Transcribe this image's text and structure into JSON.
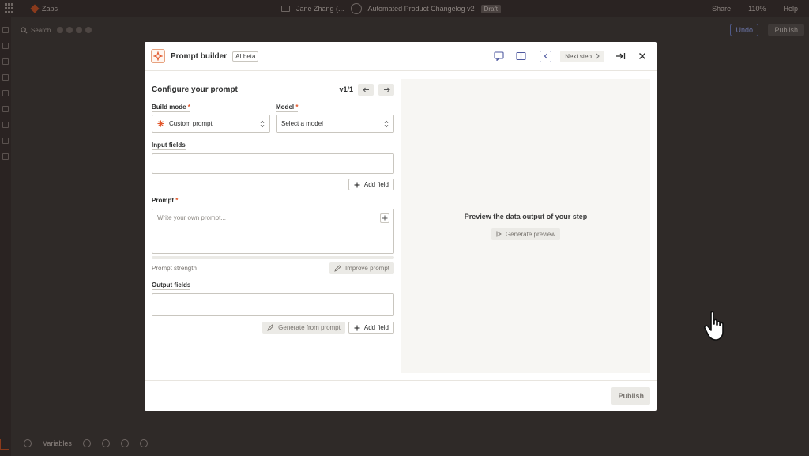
{
  "app": {
    "name": "Zaps",
    "owner": "Jane Zhang (...",
    "zap_title": "Automated Product Changelog v2",
    "status": "Draft",
    "share_label": "Share",
    "zoom": "110%",
    "help_label": "Help",
    "search_label": "Search",
    "undo_label": "Undo",
    "publish_label": "Publish",
    "variables_label": "Variables"
  },
  "modal": {
    "title": "Prompt builder",
    "badge": "AI beta",
    "next_step_label": "Next step",
    "configure_title": "Configure your prompt",
    "version": "v1/1",
    "build_mode": {
      "label": "Build mode",
      "required": "*",
      "value": "Custom prompt"
    },
    "model": {
      "label": "Model",
      "required": "*",
      "value": "Select a model"
    },
    "input_fields": {
      "label": "Input fields",
      "add_label": "Add field"
    },
    "prompt": {
      "label": "Prompt",
      "required": "*",
      "placeholder": "Write your own prompt...",
      "strength_label": "Prompt strength",
      "improve_label": "Improve prompt"
    },
    "output_fields": {
      "label": "Output fields",
      "generate_label": "Generate from prompt",
      "add_label": "Add field"
    },
    "preview": {
      "title": "Preview the data output of your step",
      "button_label": "Generate preview"
    },
    "footer_publish_label": "Publish"
  },
  "colors": {
    "accent_orange": "#e2572b",
    "accent_indigo": "#4f5aa0"
  }
}
